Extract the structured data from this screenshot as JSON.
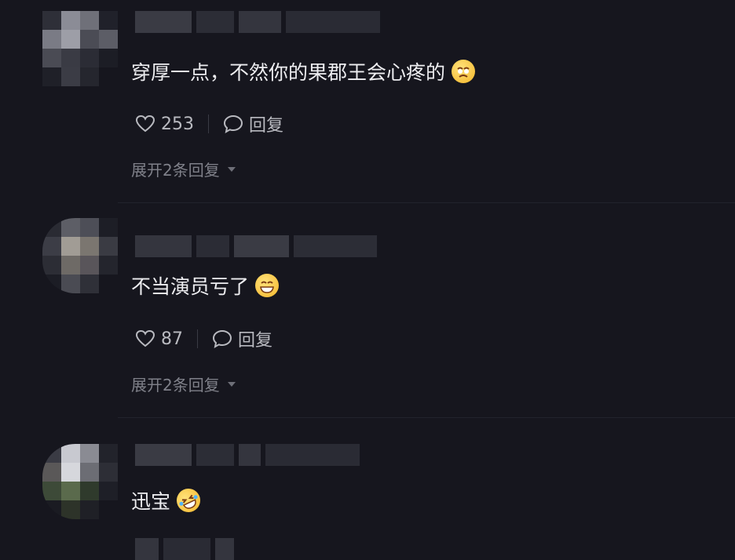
{
  "comments": [
    {
      "text": "穿厚一点，不然你的果郡王会心疼的",
      "emoji": "face-holding-back-tears-emoji",
      "likes": "253",
      "reply_label": "回复",
      "expand_label": "展开2条回复"
    },
    {
      "text": "不当演员亏了",
      "emoji": "grinning-face-emoji",
      "likes": "87",
      "reply_label": "回复",
      "expand_label": "展开2条回复"
    },
    {
      "text": "迅宝",
      "emoji": "rolling-laughing-emoji",
      "likes": "",
      "reply_label": "",
      "expand_label": ""
    }
  ],
  "colors": {
    "background": "#16161e",
    "text": "#ededf0",
    "muted": "#7f8089",
    "action": "#b9bac0"
  }
}
